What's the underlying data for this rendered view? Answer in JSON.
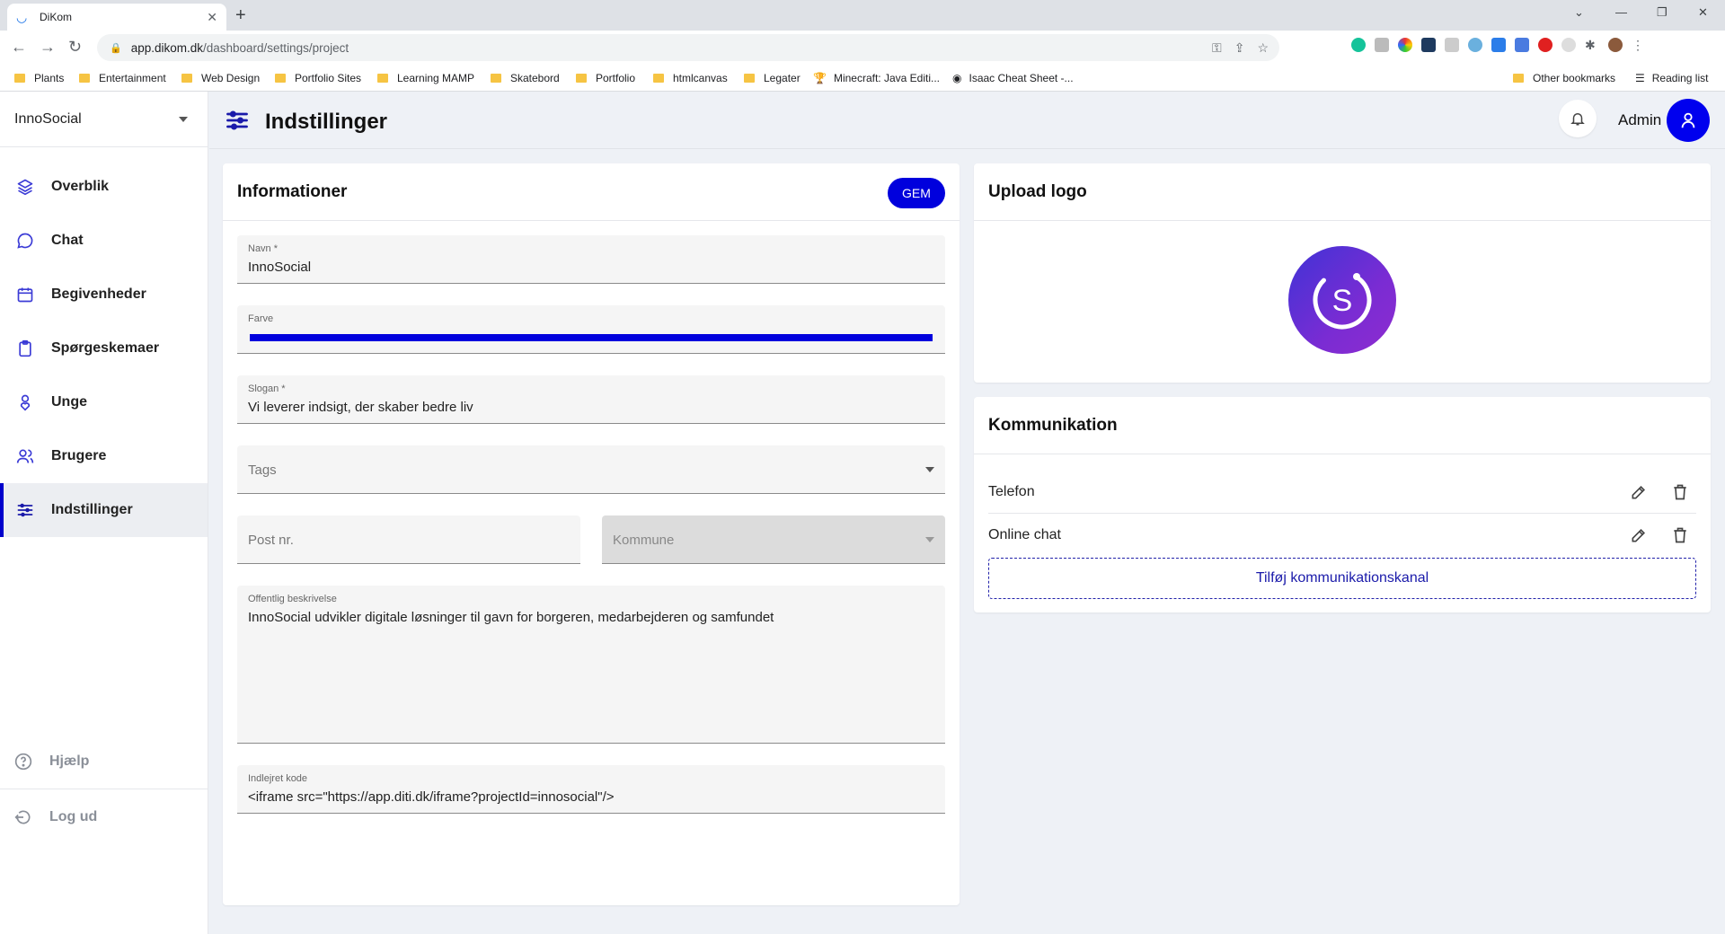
{
  "browser": {
    "tab_title": "DiKom",
    "url_host": "app.dikom.dk",
    "url_path": "/dashboard/settings/project",
    "bookmarks": [
      "Plants",
      "Entertainment",
      "Web Design",
      "Portfolio Sites",
      "Learning MAMP",
      "Skatebord",
      "Portfolio",
      "htmlcanvas",
      "Legater",
      "Minecraft: Java Editi...",
      "Isaac Cheat Sheet -..."
    ],
    "other_bookmarks": "Other bookmarks",
    "reading_list": "Reading list"
  },
  "sidebar": {
    "org_name": "InnoSocial",
    "items": [
      {
        "label": "Overblik",
        "icon": "layers-icon"
      },
      {
        "label": "Chat",
        "icon": "chat-bubble-icon"
      },
      {
        "label": "Begivenheder",
        "icon": "calendar-icon"
      },
      {
        "label": "Spørgeskemaer",
        "icon": "clipboard-icon"
      },
      {
        "label": "Unge",
        "icon": "person-heart-icon"
      },
      {
        "label": "Brugere",
        "icon": "users-icon"
      },
      {
        "label": "Indstillinger",
        "icon": "sliders-icon",
        "active": true
      }
    ],
    "help": "Hjælp",
    "logout": "Log ud"
  },
  "header": {
    "title": "Indstillinger",
    "user": "Admin"
  },
  "info_card": {
    "title": "Informationer",
    "save_label": "GEM",
    "name_label": "Navn *",
    "name_value": "InnoSocial",
    "color_label": "Farve",
    "color_value": "#0000dd",
    "slogan_label": "Slogan *",
    "slogan_value": "Vi leverer indsigt, der skaber bedre liv",
    "tags_placeholder": "Tags",
    "postnr_placeholder": "Post nr.",
    "kommune_placeholder": "Kommune",
    "description_label": "Offentlig beskrivelse",
    "description_value": "InnoSocial udvikler digitale løsninger til gavn for borgeren, medarbejderen og samfundet",
    "embed_label": "Indlejret kode",
    "embed_value": "<iframe src=\"https://app.diti.dk/iframe?projectId=innosocial\"/>"
  },
  "logo_card": {
    "title": "Upload logo",
    "logo_letter": "S"
  },
  "comm_card": {
    "title": "Kommunikation",
    "channels": [
      "Telefon",
      "Online chat"
    ],
    "add_label": "Tilføj kommunikationskanal"
  },
  "colors": {
    "accent": "#0000dd",
    "active_bar": "#0000cc",
    "background": "#eef1f6"
  }
}
